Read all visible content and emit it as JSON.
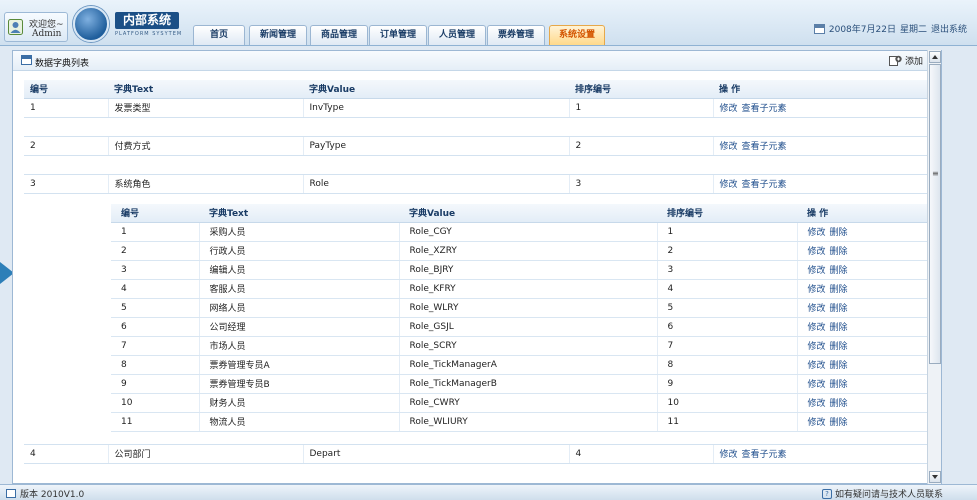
{
  "header": {
    "welcome": "欢迎您~",
    "user": "Admin",
    "logo_title": "内部系统",
    "logo_subtitle": "PLATFORM SYSYTEM",
    "tabs": [
      {
        "label": "首页"
      },
      {
        "label": "新闻管理"
      },
      {
        "label": "商品管理"
      },
      {
        "label": "订单管理"
      },
      {
        "label": "人员管理"
      },
      {
        "label": "票券管理"
      },
      {
        "label": "系统设置",
        "active": true
      }
    ],
    "date": "2008年7月22日",
    "weekday": "星期二",
    "logout": "退出系统"
  },
  "panel": {
    "title": "数据字典列表",
    "add_label": "添加"
  },
  "main_table": {
    "headers": [
      "编号",
      "字典Text",
      "字典Value",
      "排序编号",
      "操  作"
    ],
    "rows": [
      {
        "id": "1",
        "text": "发票类型",
        "value": "InvType",
        "order": "1"
      },
      {
        "id": "2",
        "text": "付费方式",
        "value": "PayType",
        "order": "2"
      },
      {
        "id": "3",
        "text": "系统角色",
        "value": "Role",
        "order": "3"
      },
      {
        "id": "4",
        "text": "公司部门",
        "value": "Depart",
        "order": "4"
      }
    ],
    "edit_label": "修改",
    "view_label": "查看子元素"
  },
  "sub_table": {
    "headers": [
      "编号",
      "字典Text",
      "字典Value",
      "排序编号",
      "操  作"
    ],
    "rows": [
      {
        "id": "1",
        "text": "采购人员",
        "value": "Role_CGY",
        "order": "1"
      },
      {
        "id": "2",
        "text": "行政人员",
        "value": "Role_XZRY",
        "order": "2"
      },
      {
        "id": "3",
        "text": "编辑人员",
        "value": "Role_BJRY",
        "order": "3"
      },
      {
        "id": "4",
        "text": "客服人员",
        "value": "Role_KFRY",
        "order": "4"
      },
      {
        "id": "5",
        "text": "网络人员",
        "value": "Role_WLRY",
        "order": "5"
      },
      {
        "id": "6",
        "text": "公司经理",
        "value": "Role_GSJL",
        "order": "6"
      },
      {
        "id": "7",
        "text": "市场人员",
        "value": "Role_SCRY",
        "order": "7"
      },
      {
        "id": "8",
        "text": "票券管理专员A",
        "value": "Role_TickManagerA",
        "order": "8"
      },
      {
        "id": "9",
        "text": "票券管理专员B",
        "value": "Role_TickManagerB",
        "order": "9"
      },
      {
        "id": "10",
        "text": "财务人员",
        "value": "Role_CWRY",
        "order": "10"
      },
      {
        "id": "11",
        "text": "物流人员",
        "value": "Role_WLIURY",
        "order": "11"
      }
    ],
    "edit_label": "修改",
    "delete_label": "删除"
  },
  "footer": {
    "version": "版本 2010V1.0",
    "contact": "如有疑问请与技术人员联系"
  },
  "colors": {
    "accent": "#d45500",
    "header_text": "#1a3c66",
    "link": "#1f4e8c"
  }
}
